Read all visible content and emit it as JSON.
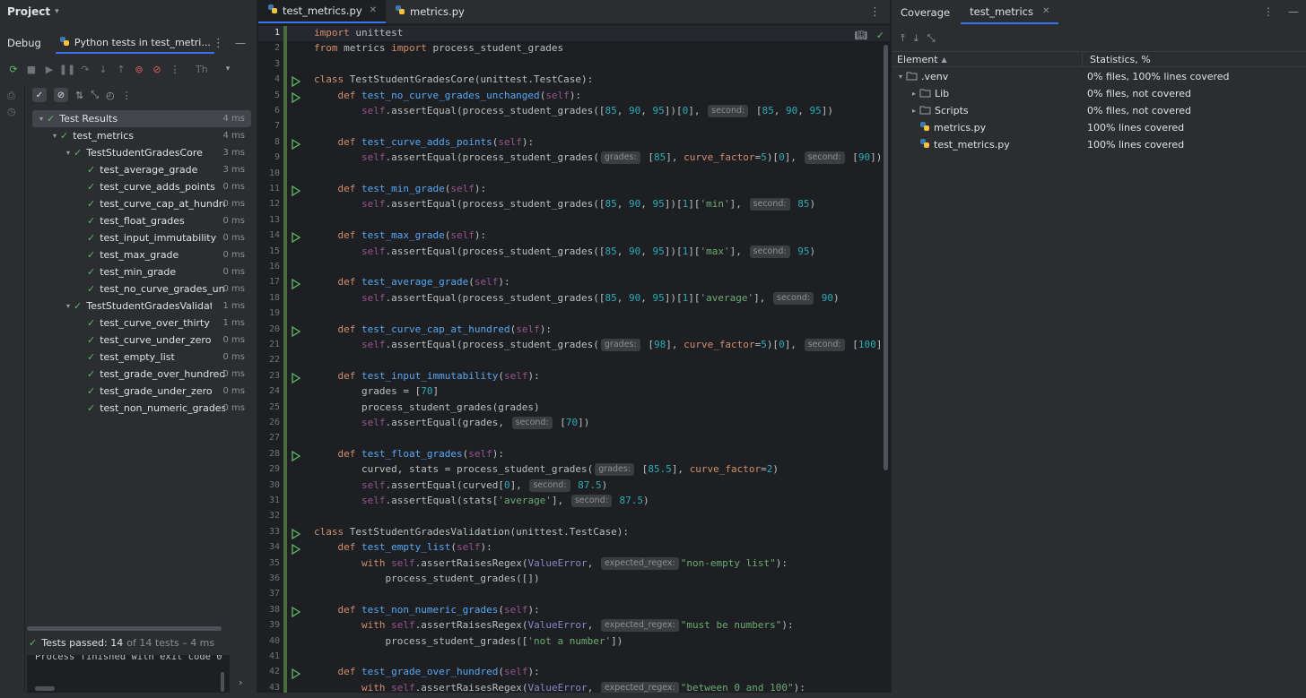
{
  "project": {
    "label": "Project"
  },
  "debug": {
    "title": "Debug",
    "tab_label": "Python tests in test_metri...",
    "threads_label": "Th"
  },
  "test_tree": [
    {
      "label": "Test Results",
      "time": "4 ms",
      "level": 0,
      "arrow": true,
      "selected": true
    },
    {
      "label": "test_metrics",
      "time": "4 ms",
      "level": 1,
      "arrow": true
    },
    {
      "label": "TestStudentGradesCore",
      "time": "3 ms",
      "level": 2,
      "arrow": true
    },
    {
      "label": "test_average_grade",
      "time": "3 ms",
      "level": 3
    },
    {
      "label": "test_curve_adds_points",
      "time": "0 ms",
      "level": 3
    },
    {
      "label": "test_curve_cap_at_hundred",
      "time": "0 ms",
      "level": 3
    },
    {
      "label": "test_float_grades",
      "time": "0 ms",
      "level": 3
    },
    {
      "label": "test_input_immutability",
      "time": "0 ms",
      "level": 3
    },
    {
      "label": "test_max_grade",
      "time": "0 ms",
      "level": 3
    },
    {
      "label": "test_min_grade",
      "time": "0 ms",
      "level": 3
    },
    {
      "label": "test_no_curve_grades_unch",
      "time": "0 ms",
      "level": 3
    },
    {
      "label": "TestStudentGradesValidation",
      "time": "1 ms",
      "level": 2,
      "arrow": true
    },
    {
      "label": "test_curve_over_thirty",
      "time": "1 ms",
      "level": 3
    },
    {
      "label": "test_curve_under_zero",
      "time": "0 ms",
      "level": 3
    },
    {
      "label": "test_empty_list",
      "time": "0 ms",
      "level": 3
    },
    {
      "label": "test_grade_over_hundred",
      "time": "0 ms",
      "level": 3
    },
    {
      "label": "test_grade_under_zero",
      "time": "0 ms",
      "level": 3
    },
    {
      "label": "test_non_numeric_grades",
      "time": "0 ms",
      "level": 3
    }
  ],
  "status": {
    "passed_label": "Tests passed: 14",
    "passed_extra": "of 14 tests – 4 ms",
    "console_line": "Process finished with exit code 0"
  },
  "editor": {
    "tabs": [
      {
        "label": "test_metrics.py",
        "active": true,
        "closable": true
      },
      {
        "label": "metrics.py",
        "active": false,
        "closable": false
      }
    ],
    "current_line": 1,
    "run_lines": [
      4,
      5,
      8,
      11,
      14,
      17,
      20,
      23,
      28,
      33,
      34,
      38,
      42
    ],
    "lines": [
      [
        [
          "k",
          "import"
        ],
        [
          "t",
          " unittest"
        ]
      ],
      [
        [
          "k",
          "from"
        ],
        [
          "t",
          " metrics "
        ],
        [
          "k",
          "import"
        ],
        [
          "t",
          " process_student_grades"
        ]
      ],
      [],
      [
        [
          "k",
          "class"
        ],
        [
          "t",
          " TestStudentGradesCore(unittest.TestCase):"
        ]
      ],
      [
        [
          "t",
          "    "
        ],
        [
          "k",
          "def"
        ],
        [
          "t",
          " "
        ],
        [
          "fn",
          "test_no_curve_grades_unchanged"
        ],
        [
          "t",
          "("
        ],
        [
          "sf",
          "self"
        ],
        [
          "t",
          "):"
        ]
      ],
      [
        [
          "t",
          "        "
        ],
        [
          "sf",
          "self"
        ],
        [
          "t",
          ".assertEqual(process_student_grades(["
        ],
        [
          "n",
          "85"
        ],
        [
          "t",
          ", "
        ],
        [
          "n",
          "90"
        ],
        [
          "t",
          ", "
        ],
        [
          "n",
          "95"
        ],
        [
          "t",
          "])["
        ],
        [
          "n",
          "0"
        ],
        [
          "t",
          "], "
        ],
        [
          "h",
          "second:"
        ],
        [
          "t",
          " ["
        ],
        [
          "n",
          "85"
        ],
        [
          "t",
          ", "
        ],
        [
          "n",
          "90"
        ],
        [
          "t",
          ", "
        ],
        [
          "n",
          "95"
        ],
        [
          "t",
          "])"
        ]
      ],
      [],
      [
        [
          "t",
          "    "
        ],
        [
          "k",
          "def"
        ],
        [
          "t",
          " "
        ],
        [
          "fn",
          "test_curve_adds_points"
        ],
        [
          "t",
          "("
        ],
        [
          "sf",
          "self"
        ],
        [
          "t",
          "):"
        ]
      ],
      [
        [
          "t",
          "        "
        ],
        [
          "sf",
          "self"
        ],
        [
          "t",
          ".assertEqual(process_student_grades("
        ],
        [
          "h",
          "grades:"
        ],
        [
          "t",
          " ["
        ],
        [
          "n",
          "85"
        ],
        [
          "t",
          "], "
        ],
        [
          "pm",
          "curve_factor"
        ],
        [
          "t",
          "="
        ],
        [
          "n",
          "5"
        ],
        [
          "t",
          ")["
        ],
        [
          "n",
          "0"
        ],
        [
          "t",
          "], "
        ],
        [
          "h",
          "second:"
        ],
        [
          "t",
          " ["
        ],
        [
          "n",
          "90"
        ],
        [
          "t",
          "])"
        ]
      ],
      [],
      [
        [
          "t",
          "    "
        ],
        [
          "k",
          "def"
        ],
        [
          "t",
          " "
        ],
        [
          "fn",
          "test_min_grade"
        ],
        [
          "t",
          "("
        ],
        [
          "sf",
          "self"
        ],
        [
          "t",
          "):"
        ]
      ],
      [
        [
          "t",
          "        "
        ],
        [
          "sf",
          "self"
        ],
        [
          "t",
          ".assertEqual(process_student_grades(["
        ],
        [
          "n",
          "85"
        ],
        [
          "t",
          ", "
        ],
        [
          "n",
          "90"
        ],
        [
          "t",
          ", "
        ],
        [
          "n",
          "95"
        ],
        [
          "t",
          "])["
        ],
        [
          "n",
          "1"
        ],
        [
          "t",
          "]["
        ],
        [
          "s",
          "'min'"
        ],
        [
          "t",
          "], "
        ],
        [
          "h",
          "second:"
        ],
        [
          "t",
          " "
        ],
        [
          "n",
          "85"
        ],
        [
          "t",
          ")"
        ]
      ],
      [],
      [
        [
          "t",
          "    "
        ],
        [
          "k",
          "def"
        ],
        [
          "t",
          " "
        ],
        [
          "fn",
          "test_max_grade"
        ],
        [
          "t",
          "("
        ],
        [
          "sf",
          "self"
        ],
        [
          "t",
          "):"
        ]
      ],
      [
        [
          "t",
          "        "
        ],
        [
          "sf",
          "self"
        ],
        [
          "t",
          ".assertEqual(process_student_grades(["
        ],
        [
          "n",
          "85"
        ],
        [
          "t",
          ", "
        ],
        [
          "n",
          "90"
        ],
        [
          "t",
          ", "
        ],
        [
          "n",
          "95"
        ],
        [
          "t",
          "])["
        ],
        [
          "n",
          "1"
        ],
        [
          "t",
          "]["
        ],
        [
          "s",
          "'max'"
        ],
        [
          "t",
          "], "
        ],
        [
          "h",
          "second:"
        ],
        [
          "t",
          " "
        ],
        [
          "n",
          "95"
        ],
        [
          "t",
          ")"
        ]
      ],
      [],
      [
        [
          "t",
          "    "
        ],
        [
          "k",
          "def"
        ],
        [
          "t",
          " "
        ],
        [
          "fn",
          "test_average_grade"
        ],
        [
          "t",
          "("
        ],
        [
          "sf",
          "self"
        ],
        [
          "t",
          "):"
        ]
      ],
      [
        [
          "t",
          "        "
        ],
        [
          "sf",
          "self"
        ],
        [
          "t",
          ".assertEqual(process_student_grades(["
        ],
        [
          "n",
          "85"
        ],
        [
          "t",
          ", "
        ],
        [
          "n",
          "90"
        ],
        [
          "t",
          ", "
        ],
        [
          "n",
          "95"
        ],
        [
          "t",
          "])["
        ],
        [
          "n",
          "1"
        ],
        [
          "t",
          "]["
        ],
        [
          "s",
          "'average'"
        ],
        [
          "t",
          "], "
        ],
        [
          "h",
          "second:"
        ],
        [
          "t",
          " "
        ],
        [
          "n",
          "90"
        ],
        [
          "t",
          ")"
        ]
      ],
      [],
      [
        [
          "t",
          "    "
        ],
        [
          "k",
          "def"
        ],
        [
          "t",
          " "
        ],
        [
          "fn",
          "test_curve_cap_at_hundred"
        ],
        [
          "t",
          "("
        ],
        [
          "sf",
          "self"
        ],
        [
          "t",
          "):"
        ]
      ],
      [
        [
          "t",
          "        "
        ],
        [
          "sf",
          "self"
        ],
        [
          "t",
          ".assertEqual(process_student_grades("
        ],
        [
          "h",
          "grades:"
        ],
        [
          "t",
          " ["
        ],
        [
          "n",
          "98"
        ],
        [
          "t",
          "], "
        ],
        [
          "pm",
          "curve_factor"
        ],
        [
          "t",
          "="
        ],
        [
          "n",
          "5"
        ],
        [
          "t",
          ")["
        ],
        [
          "n",
          "0"
        ],
        [
          "t",
          "], "
        ],
        [
          "h",
          "second:"
        ],
        [
          "t",
          " ["
        ],
        [
          "n",
          "100"
        ],
        [
          "t",
          "])"
        ]
      ],
      [],
      [
        [
          "t",
          "    "
        ],
        [
          "k",
          "def"
        ],
        [
          "t",
          " "
        ],
        [
          "fn",
          "test_input_immutability"
        ],
        [
          "t",
          "("
        ],
        [
          "sf",
          "self"
        ],
        [
          "t",
          "):"
        ]
      ],
      [
        [
          "t",
          "        grades = ["
        ],
        [
          "n",
          "70"
        ],
        [
          "t",
          "]"
        ]
      ],
      [
        [
          "t",
          "        process_student_grades(grades)"
        ]
      ],
      [
        [
          "t",
          "        "
        ],
        [
          "sf",
          "self"
        ],
        [
          "t",
          ".assertEqual(grades, "
        ],
        [
          "h",
          "second:"
        ],
        [
          "t",
          " ["
        ],
        [
          "n",
          "70"
        ],
        [
          "t",
          "])"
        ]
      ],
      [],
      [
        [
          "t",
          "    "
        ],
        [
          "k",
          "def"
        ],
        [
          "t",
          " "
        ],
        [
          "fn",
          "test_float_grades"
        ],
        [
          "t",
          "("
        ],
        [
          "sf",
          "self"
        ],
        [
          "t",
          "):"
        ]
      ],
      [
        [
          "t",
          "        curved, stats = process_student_grades("
        ],
        [
          "h",
          "grades:"
        ],
        [
          "t",
          " ["
        ],
        [
          "n",
          "85.5"
        ],
        [
          "t",
          "], "
        ],
        [
          "pm",
          "curve_factor"
        ],
        [
          "t",
          "="
        ],
        [
          "n",
          "2"
        ],
        [
          "t",
          ")"
        ]
      ],
      [
        [
          "t",
          "        "
        ],
        [
          "sf",
          "self"
        ],
        [
          "t",
          ".assertEqual(curved["
        ],
        [
          "n",
          "0"
        ],
        [
          "t",
          "], "
        ],
        [
          "h",
          "second:"
        ],
        [
          "t",
          " "
        ],
        [
          "n",
          "87.5"
        ],
        [
          "t",
          ")"
        ]
      ],
      [
        [
          "t",
          "        "
        ],
        [
          "sf",
          "self"
        ],
        [
          "t",
          ".assertEqual(stats["
        ],
        [
          "s",
          "'average'"
        ],
        [
          "t",
          "], "
        ],
        [
          "h",
          "second:"
        ],
        [
          "t",
          " "
        ],
        [
          "n",
          "87.5"
        ],
        [
          "t",
          ")"
        ]
      ],
      [],
      [
        [
          "k",
          "class"
        ],
        [
          "t",
          " TestStudentGradesValidation(unittest.TestCase):"
        ]
      ],
      [
        [
          "t",
          "    "
        ],
        [
          "k",
          "def"
        ],
        [
          "t",
          " "
        ],
        [
          "fn",
          "test_empty_list"
        ],
        [
          "t",
          "("
        ],
        [
          "sf",
          "self"
        ],
        [
          "t",
          "):"
        ]
      ],
      [
        [
          "t",
          "        "
        ],
        [
          "k",
          "with"
        ],
        [
          "t",
          " "
        ],
        [
          "sf",
          "self"
        ],
        [
          "t",
          ".assertRaisesRegex("
        ],
        [
          "bi",
          "ValueError"
        ],
        [
          "t",
          ", "
        ],
        [
          "h",
          "expected_regex:"
        ],
        [
          "s",
          "\"non-empty list\""
        ],
        [
          "t",
          "):"
        ]
      ],
      [
        [
          "t",
          "            process_student_grades([])"
        ]
      ],
      [],
      [
        [
          "t",
          "    "
        ],
        [
          "k",
          "def"
        ],
        [
          "t",
          " "
        ],
        [
          "fn",
          "test_non_numeric_grades"
        ],
        [
          "t",
          "("
        ],
        [
          "sf",
          "self"
        ],
        [
          "t",
          "):"
        ]
      ],
      [
        [
          "t",
          "        "
        ],
        [
          "k",
          "with"
        ],
        [
          "t",
          " "
        ],
        [
          "sf",
          "self"
        ],
        [
          "t",
          ".assertRaisesRegex("
        ],
        [
          "bi",
          "ValueError"
        ],
        [
          "t",
          ", "
        ],
        [
          "h",
          "expected_regex:"
        ],
        [
          "s",
          "\"must be numbers\""
        ],
        [
          "t",
          "):"
        ]
      ],
      [
        [
          "t",
          "            process_student_grades(["
        ],
        [
          "s",
          "'not a number'"
        ],
        [
          "t",
          "])"
        ]
      ],
      [],
      [
        [
          "t",
          "    "
        ],
        [
          "k",
          "def"
        ],
        [
          "t",
          " "
        ],
        [
          "fn",
          "test_grade_over_hundred"
        ],
        [
          "t",
          "("
        ],
        [
          "sf",
          "self"
        ],
        [
          "t",
          "):"
        ]
      ],
      [
        [
          "t",
          "        "
        ],
        [
          "k",
          "with"
        ],
        [
          "t",
          " "
        ],
        [
          "sf",
          "self"
        ],
        [
          "t",
          ".assertRaisesRegex("
        ],
        [
          "bi",
          "ValueError"
        ],
        [
          "t",
          ", "
        ],
        [
          "h",
          "expected_regex:"
        ],
        [
          "s",
          "\"between 0 and 100\""
        ],
        [
          "t",
          "):"
        ]
      ]
    ]
  },
  "coverage": {
    "title": "Coverage",
    "tab_label": "test_metrics",
    "col_element": "Element",
    "col_stats": "Statistics, %",
    "rows": [
      {
        "name": ".venv",
        "stats": "0% files, 100% lines covered",
        "kind": "folder",
        "level": 0,
        "arrow": "down"
      },
      {
        "name": "Lib",
        "stats": "0% files, not covered",
        "kind": "folder",
        "level": 1,
        "arrow": "right"
      },
      {
        "name": "Scripts",
        "stats": "0% files, not covered",
        "kind": "folder",
        "level": 1,
        "arrow": "right"
      },
      {
        "name": "metrics.py",
        "stats": "100% lines covered",
        "kind": "python",
        "level": 1
      },
      {
        "name": "test_metrics.py",
        "stats": "100% lines covered",
        "kind": "python",
        "level": 1
      }
    ]
  },
  "colors": {
    "accent": "#3574f0",
    "pass_green": "#5fb865",
    "coverage_green": "#4a6d3f"
  }
}
